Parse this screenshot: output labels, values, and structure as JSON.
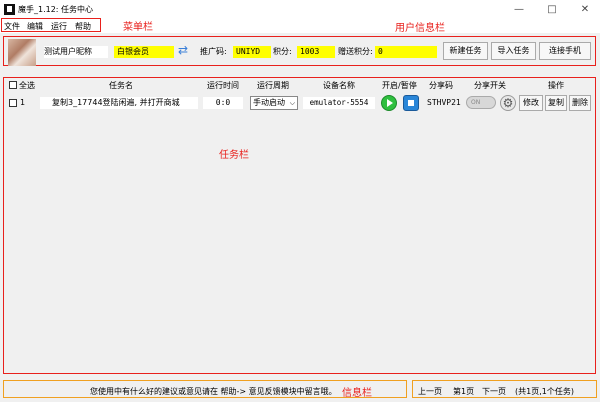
{
  "window": {
    "title": "魔手_1.12: 任务中心",
    "min": "—",
    "max": "□",
    "close": "✕"
  },
  "menu": {
    "items": [
      "文件",
      "编辑",
      "运行",
      "帮助"
    ],
    "annotation": "菜单栏"
  },
  "user": {
    "annotation": "用户信息栏",
    "nickname": "测试用户昵称",
    "level": "白银会员",
    "promo_label": "推广码:",
    "promo_code": "UNIYD",
    "points_label": "积分:",
    "points": "1003",
    "gift_label": "赠送积分:",
    "gift_points": "0",
    "buttons": {
      "new_task": "新建任务",
      "import_task": "导入任务",
      "connect_phone": "连接手机"
    }
  },
  "tasks": {
    "annotation": "任务栏",
    "columns": {
      "select_all": "全选",
      "name": "任务名",
      "run_time": "运行时间",
      "cycle": "运行周期",
      "device": "设备名称",
      "toggle": "开启/暂停",
      "share_code": "分享码",
      "share_switch": "分享开关",
      "ops": "操作"
    },
    "rows": [
      {
        "index": "1",
        "name": "复制3_17744登陆闲遍, 并打开商城",
        "time": "0:0",
        "cycle": "手动启动",
        "device": "emulator-5554",
        "share_code": "STHVP21",
        "switch_text": "ON",
        "edit": "修改",
        "copy": "复制",
        "delete": "删除"
      }
    ]
  },
  "info": {
    "annotation": "信息栏",
    "message": "您使用中有什么好的建议或意见请在  帮助-> 意见反馈模块中留言哦。",
    "prev": "上一页",
    "page": "第1页",
    "next": "下一页",
    "summary": "(共1页,1个任务)"
  },
  "colors": {
    "annotation_red": "#e8201c",
    "highlight_yellow": "#ffff00",
    "info_frame": "#f0a020"
  }
}
